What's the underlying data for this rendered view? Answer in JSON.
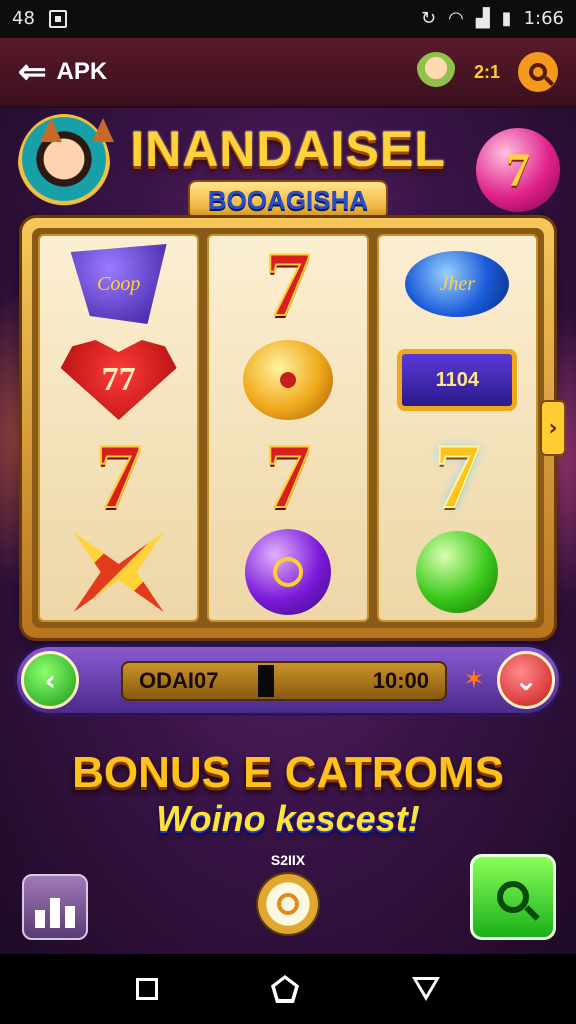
{
  "status": {
    "left_text": "48",
    "time": "1:66"
  },
  "app_bar": {
    "back_label": "APK",
    "coin_count": "2:1"
  },
  "game": {
    "title": "INANDAISEL",
    "subtitle": "BOOAGISHA",
    "reels": [
      {
        "symbols": [
          {
            "kind": "shield",
            "text": "Coop"
          },
          {
            "kind": "heart",
            "text": "77"
          },
          {
            "kind": "seven",
            "text": "7"
          },
          {
            "kind": "bow",
            "text": ""
          }
        ]
      },
      {
        "symbols": [
          {
            "kind": "seven",
            "text": "7"
          },
          {
            "kind": "coin",
            "text": ""
          },
          {
            "kind": "seven",
            "text": "7"
          },
          {
            "kind": "purple-orb",
            "text": ""
          }
        ]
      },
      {
        "symbols": [
          {
            "kind": "blue-oval",
            "text": "Jher"
          },
          {
            "kind": "plaque",
            "text": "1104"
          },
          {
            "kind": "seven-gold",
            "text": "7"
          },
          {
            "kind": "apple",
            "text": ""
          }
        ]
      }
    ],
    "orb_symbol": "7",
    "balance_label": "ODAI07",
    "balance_value": "10:00",
    "bonus_title": "BONUS E CATROMS",
    "bonus_subtitle": "Woino kescest!",
    "timer_label": "S2IIX"
  },
  "colors": {
    "title_gold": "#ffd23a",
    "subtitle_blue": "#2a4ec8",
    "spin_green": "#1a9a1a",
    "stop_red": "#c81a1a"
  },
  "icons": {
    "status_photo": "image-icon",
    "back": "arrow-left-icon",
    "search": "search-icon",
    "stats": "bar-chart-icon",
    "timer": "timer-icon"
  }
}
